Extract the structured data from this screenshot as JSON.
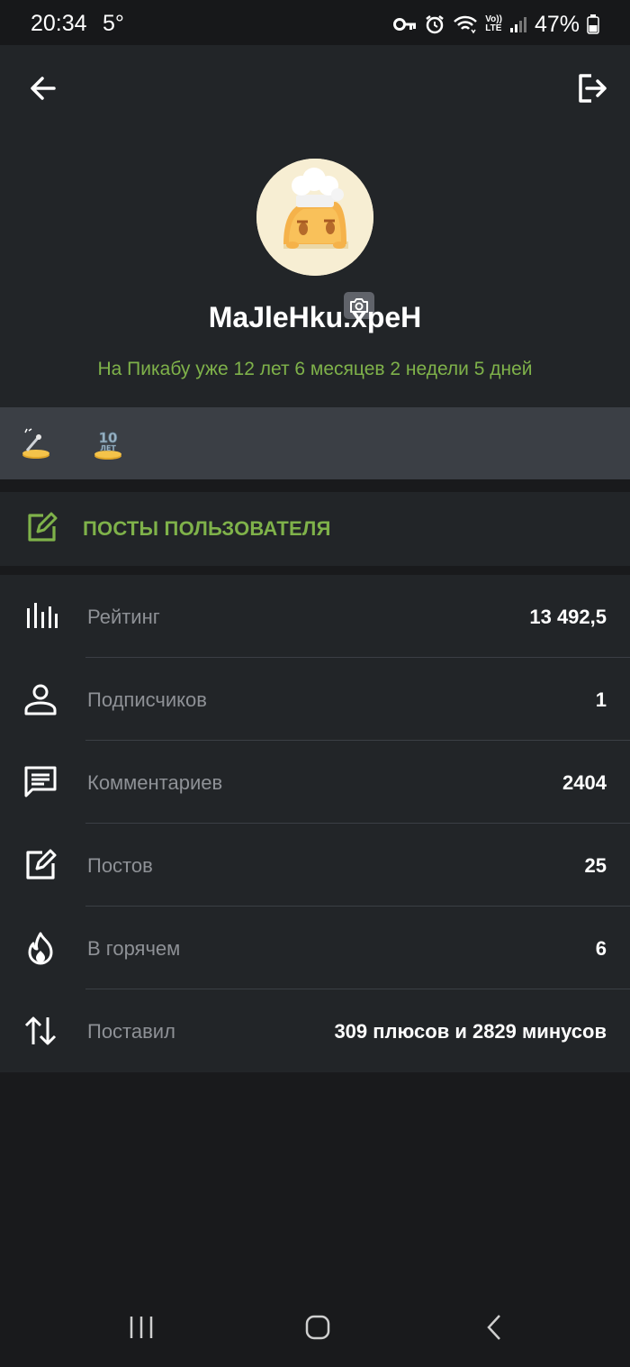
{
  "status_bar": {
    "time": "20:34",
    "temperature": "5°",
    "battery": "47%",
    "lte_top": "Vo))",
    "lte_bottom": "LTE"
  },
  "profile": {
    "username": "MaJleHku.xpeH",
    "tenure": "На Пикабу уже 12 лет 6 месяцев 2 недели 5 дней"
  },
  "awards": {
    "items": [
      {
        "icon": "wand-award-icon"
      },
      {
        "icon": "ten-years-award-icon",
        "text": "10",
        "subtext": "ЛЕТ"
      }
    ]
  },
  "posts_button": {
    "label": "ПОСТЫ ПОЛЬЗОВАТЕЛЯ"
  },
  "stats": [
    {
      "icon": "bar-chart-icon",
      "label": "Рейтинг",
      "value": "13 492,5"
    },
    {
      "icon": "user-icon",
      "label": "Подписчиков",
      "value": "1"
    },
    {
      "icon": "comment-icon",
      "label": "Комментариев",
      "value": "2404"
    },
    {
      "icon": "edit-icon",
      "label": "Постов",
      "value": "25"
    },
    {
      "icon": "fire-icon",
      "label": "В горячем",
      "value": "6"
    },
    {
      "icon": "arrows-updown-icon",
      "label": "Поставил",
      "value": "309 плюсов и 2829 минусов"
    }
  ],
  "colors": {
    "accent_green": "#7fb24a",
    "header_bg": "#222528",
    "awards_bg": "#3b3f45",
    "page_bg": "#191a1c"
  }
}
